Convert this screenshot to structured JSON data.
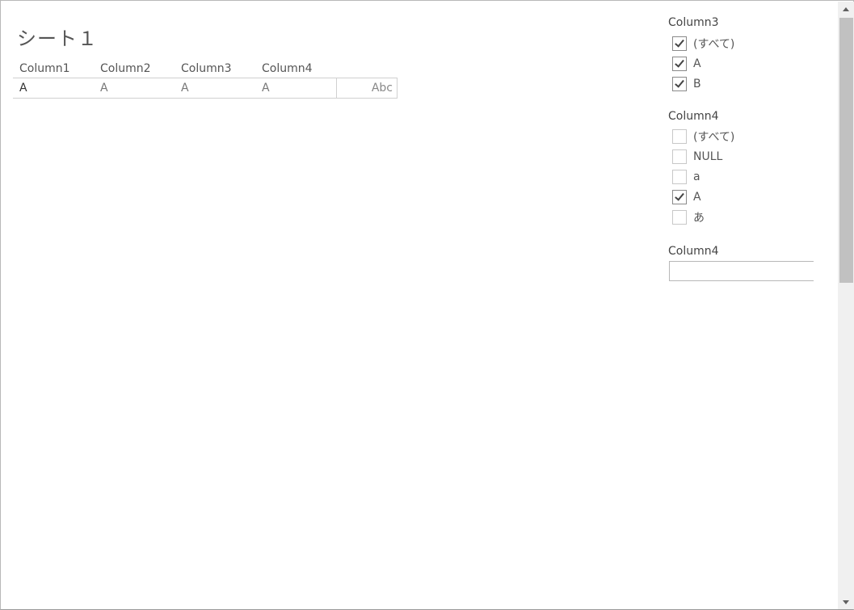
{
  "sheet": {
    "title": "シート１",
    "columns": [
      "Column1",
      "Column2",
      "Column3",
      "Column4"
    ],
    "row": [
      "A",
      "A",
      "A",
      "A"
    ],
    "extra_cell": "Abc"
  },
  "filters": {
    "column3": {
      "title": "Column3",
      "items": [
        {
          "label": "(すべて)",
          "checked": true
        },
        {
          "label": "A",
          "checked": true
        },
        {
          "label": "B",
          "checked": true
        }
      ]
    },
    "column4": {
      "title": "Column4",
      "items": [
        {
          "label": "(すべて)",
          "checked": false
        },
        {
          "label": "NULL",
          "checked": false
        },
        {
          "label": "a",
          "checked": false
        },
        {
          "label": "A",
          "checked": true
        },
        {
          "label": "あ",
          "checked": false
        }
      ]
    },
    "column4_text": {
      "title": "Column4",
      "value": ""
    }
  },
  "icons": {
    "check": "check-icon",
    "scroll_up": "arrow-up-icon",
    "scroll_down": "arrow-down-icon"
  }
}
